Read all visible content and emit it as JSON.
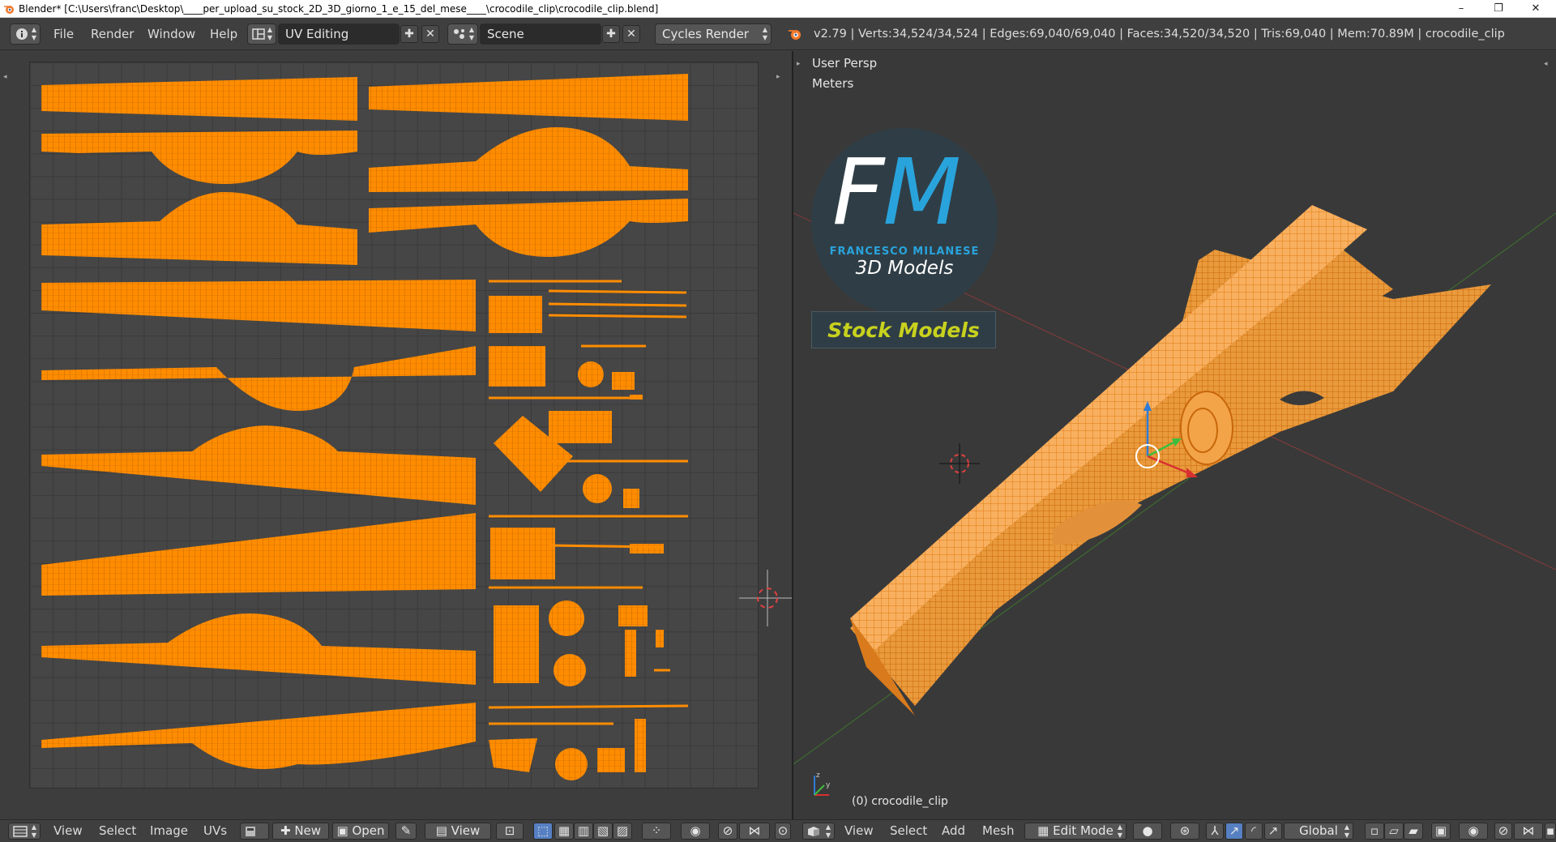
{
  "window": {
    "title": "Blender* [C:\\Users\\franc\\Desktop\\____per_upload_su_stock_2D_3D_giorno_1_e_15_del_mese____\\crocodile_clip\\crocodile_clip.blend]",
    "minimize": "–",
    "maximize": "❐",
    "close": "✕"
  },
  "topbar": {
    "menus": [
      "File",
      "Render",
      "Window",
      "Help"
    ],
    "layout": "UV Editing",
    "scene": "Scene",
    "engine": "Cycles Render",
    "stats": "v2.79 | Verts:34,524/34,524 | Edges:69,040/69,040 | Faces:34,520/34,520 | Tris:69,040 | Mem:70.89M | crocodile_clip"
  },
  "viewport": {
    "view_name": "User Persp",
    "units": "Meters",
    "object_label": "(0) crocodile_clip",
    "logo_text": "FM",
    "logo_name": "FRANCESCO MILANESE",
    "logo_sub": "3D Models",
    "logo_tag": "Stock Models"
  },
  "uv_bottombar": {
    "menus": [
      "View",
      "Select",
      "Image",
      "UVs"
    ],
    "new_label": "New",
    "open_label": "Open",
    "view_label": "View"
  },
  "view_bottombar": {
    "menus": [
      "View",
      "Select",
      "Add",
      "Mesh"
    ],
    "mode": "Edit Mode",
    "orientation": "Global"
  },
  "colors": {
    "accent": "#ff8c00",
    "logo_circle": "#2f3e46",
    "logo_blue": "#29a3dc",
    "logo_tag": "#c8d21e"
  }
}
